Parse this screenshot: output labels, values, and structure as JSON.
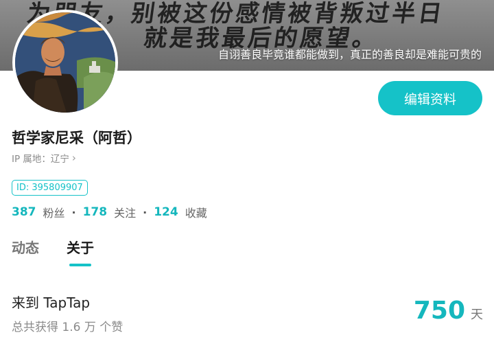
{
  "banner": {
    "calligraphy_line1": "为朋友，别被这份感情被背叛过半日",
    "calligraphy_line2": "就是我最后的愿望。",
    "quote": "自诩善良毕竟谁都能做到，真正的善良却是难能可贵的"
  },
  "profile": {
    "name": "哲学家尼采（阿哲）",
    "ip_label": "IP 属地：辽宁",
    "id_label": "ID: 395809907",
    "edit_button": "编辑资料"
  },
  "stats": [
    {
      "value": "387",
      "label": "粉丝"
    },
    {
      "value": "178",
      "label": "关注"
    },
    {
      "value": "124",
      "label": "收藏"
    }
  ],
  "tabs": [
    {
      "label": "动态",
      "active": false
    },
    {
      "label": "关于",
      "active": true
    }
  ],
  "about": {
    "come_title": "来到 TapTap",
    "likes": "总共获得 1.6 万 个赞",
    "days_value": "750",
    "days_unit": "天"
  },
  "colors": {
    "accent": "#15c2c8"
  },
  "icons": {
    "ip_chevron": "chevron-right-icon"
  }
}
